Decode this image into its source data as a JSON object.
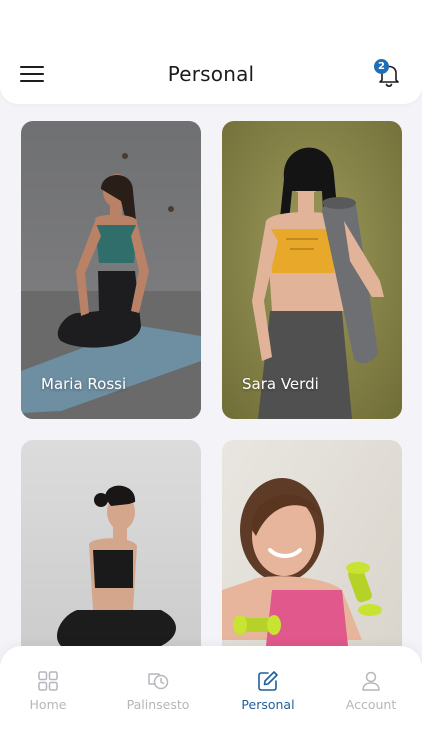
{
  "header": {
    "title": "Personal",
    "notification_count": "2"
  },
  "trainers": [
    {
      "name": "Maria Rossi"
    },
    {
      "name": "Sara Verdi"
    },
    {
      "name": ""
    },
    {
      "name": ""
    }
  ],
  "tabbar": {
    "items": [
      {
        "label": "Home",
        "icon": "grid-icon"
      },
      {
        "label": "Palinsesto",
        "icon": "schedule-icon"
      },
      {
        "label": "Personal",
        "icon": "edit-icon",
        "active": true
      },
      {
        "label": "Account",
        "icon": "user-icon"
      }
    ]
  },
  "colors": {
    "accent": "#1f5f9e",
    "badge": "#1f6fb8",
    "inactive": "#b6b6bc"
  }
}
